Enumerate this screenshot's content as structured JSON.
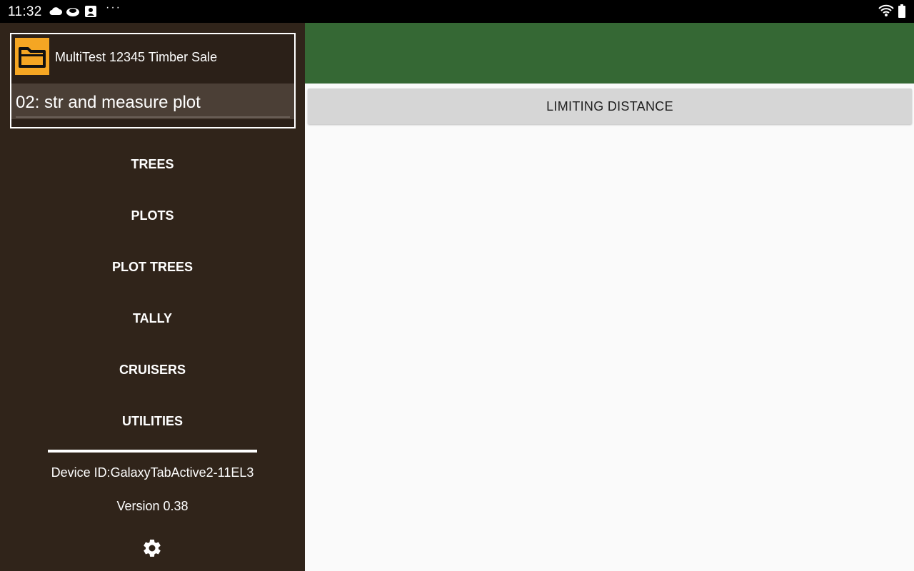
{
  "status_bar": {
    "time": "11:32",
    "overflow": "···",
    "icons": [
      "cloud-icon",
      "data-saver-icon",
      "notification-icon",
      "wifi-icon",
      "battery-icon"
    ]
  },
  "drawer": {
    "sale_title": "MultiTest 12345 Timber Sale",
    "stratum": "02: str and measure plot",
    "nav_items": [
      "TREES",
      "PLOTS",
      "PLOT TREES",
      "TALLY",
      "CRUISERS",
      "UTILITIES"
    ],
    "device_id": "Device ID:GalaxyTabActive2-11EL3",
    "version": "Version 0.38"
  },
  "main": {
    "limiting_distance_label": "LIMITING DISTANCE"
  },
  "colors": {
    "drawer_bg": "#30241a",
    "app_bar": "#356834",
    "folder_accent": "#f5a623",
    "content_bg": "#fafafa"
  }
}
